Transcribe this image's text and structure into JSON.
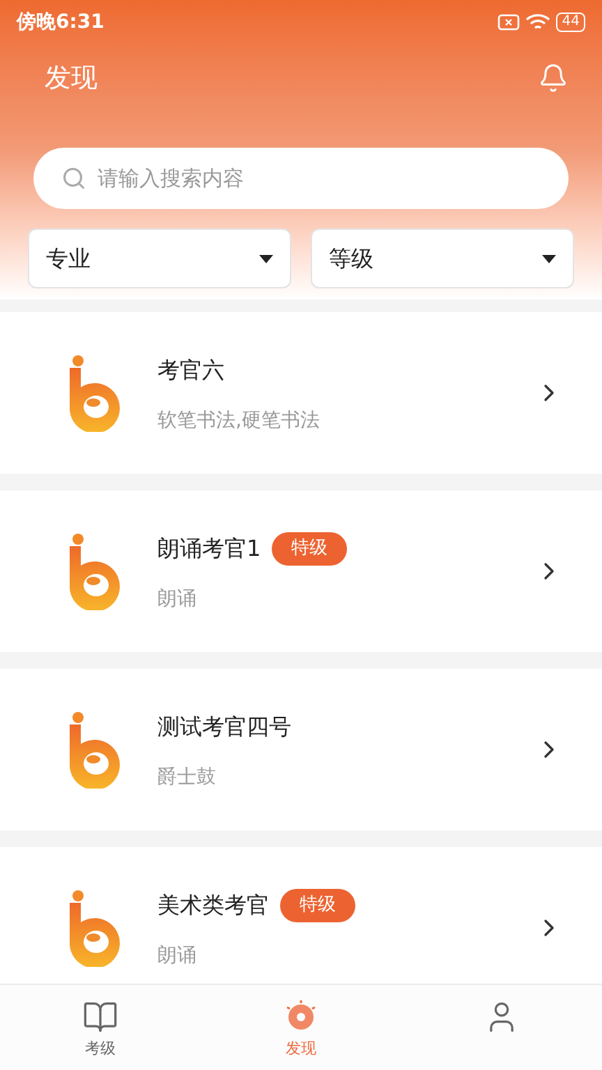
{
  "status_bar": {
    "time": "傍晚6:31",
    "battery": "44"
  },
  "header": {
    "title": "发现"
  },
  "search": {
    "placeholder": "请输入搜索内容"
  },
  "filters": [
    {
      "label": "专业"
    },
    {
      "label": "等级"
    }
  ],
  "examiners": [
    {
      "name": "考官六",
      "subtitle": "软笔书法,硬笔书法"
    },
    {
      "name": "朗诵考官1",
      "badge": "特级",
      "subtitle": "朗诵"
    },
    {
      "name": "测试考官四号",
      "subtitle": "爵士鼓"
    },
    {
      "name": "美术类考官",
      "badge": "特级",
      "subtitle": "朗诵"
    }
  ],
  "bottom_nav": [
    {
      "kind": "book",
      "label": "考级",
      "selected": false
    },
    {
      "kind": "bulb",
      "label": "发现",
      "selected": true
    },
    {
      "kind": "user",
      "selected": false
    }
  ]
}
